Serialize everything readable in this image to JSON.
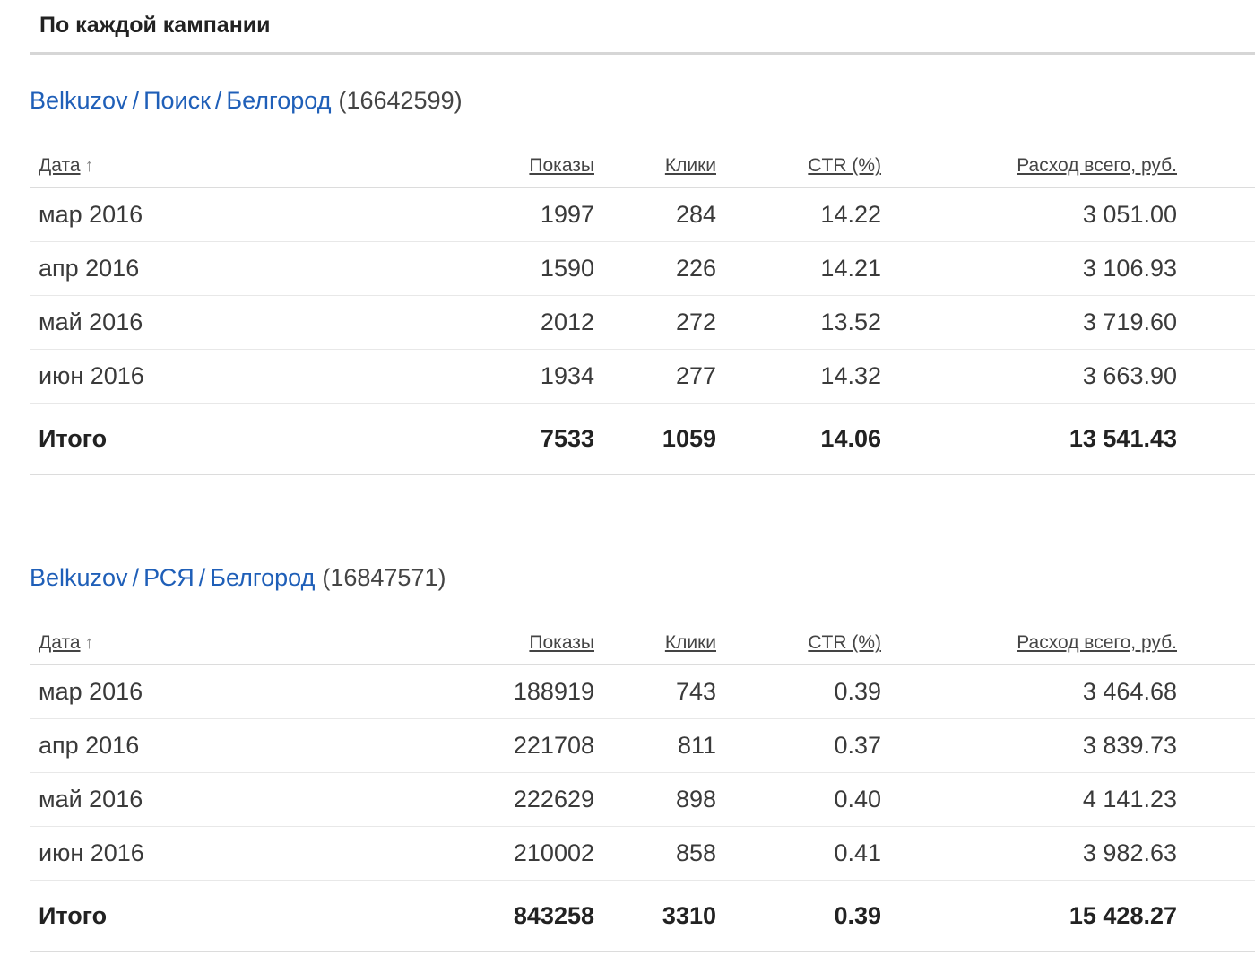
{
  "section": {
    "title": "По каждой кампании"
  },
  "columns": {
    "date": "Дата",
    "date_sort_icon": "arrow-up-icon",
    "shows": "Показы",
    "clicks": "Клики",
    "ctr": "CTR (%)",
    "spend": "Расход всего, руб."
  },
  "campaigns": [
    {
      "crumbs": [
        "Belkuzov",
        "Поиск",
        "Белгород"
      ],
      "separator": "/",
      "id": "(16642599)",
      "rows": [
        {
          "date": "мар 2016",
          "shows": "1997",
          "clicks": "284",
          "ctr": "14.22",
          "spend": "3 051.00"
        },
        {
          "date": "апр 2016",
          "shows": "1590",
          "clicks": "226",
          "ctr": "14.21",
          "spend": "3 106.93"
        },
        {
          "date": "май 2016",
          "shows": "2012",
          "clicks": "272",
          "ctr": "13.52",
          "spend": "3 719.60"
        },
        {
          "date": "июн 2016",
          "shows": "1934",
          "clicks": "277",
          "ctr": "14.32",
          "spend": "3 663.90"
        }
      ],
      "total": {
        "label": "Итого",
        "shows": "7533",
        "clicks": "1059",
        "ctr": "14.06",
        "spend": "13 541.43"
      }
    },
    {
      "crumbs": [
        "Belkuzov",
        "РСЯ",
        "Белгород"
      ],
      "separator": "/",
      "id": "(16847571)",
      "rows": [
        {
          "date": "мар 2016",
          "shows": "188919",
          "clicks": "743",
          "ctr": "0.39",
          "spend": "3 464.68"
        },
        {
          "date": "апр 2016",
          "shows": "221708",
          "clicks": "811",
          "ctr": "0.37",
          "spend": "3 839.73"
        },
        {
          "date": "май 2016",
          "shows": "222629",
          "clicks": "898",
          "ctr": "0.40",
          "spend": "4 141.23"
        },
        {
          "date": "июн 2016",
          "shows": "210002",
          "clicks": "858",
          "ctr": "0.41",
          "spend": "3 982.63"
        }
      ],
      "total": {
        "label": "Итого",
        "shows": "843258",
        "clicks": "3310",
        "ctr": "0.39",
        "spend": "15 428.27"
      }
    }
  ]
}
